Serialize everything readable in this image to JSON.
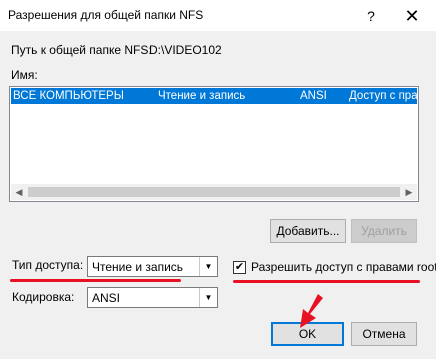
{
  "window": {
    "title": "Разрешения для общей папки NFS",
    "help_glyph": "?",
    "close_glyph": "✕"
  },
  "path": {
    "label": "Путь к общей папке NFS:",
    "value": "D:\\VIDEO102"
  },
  "names": {
    "label": "Имя:",
    "rows": [
      {
        "name": "ВСЕ КОМПЬЮТЕРЫ",
        "access": "Чтение и запись",
        "encoding": "ANSI",
        "root": "Доступ с прав"
      }
    ]
  },
  "buttons": {
    "add": "Добавить...",
    "remove": "Удалить",
    "ok": "OK",
    "cancel": "Отмена"
  },
  "access": {
    "label": "Тип доступа:",
    "value": "Чтение и запись"
  },
  "encoding": {
    "label": "Кодировка:",
    "value": "ANSI"
  },
  "root_checkbox": {
    "label": "Разрешить доступ с правами root",
    "checked": true,
    "check_glyph": "✔"
  },
  "colors": {
    "selection": "#0078d7",
    "annotation_red": "#e81123"
  }
}
